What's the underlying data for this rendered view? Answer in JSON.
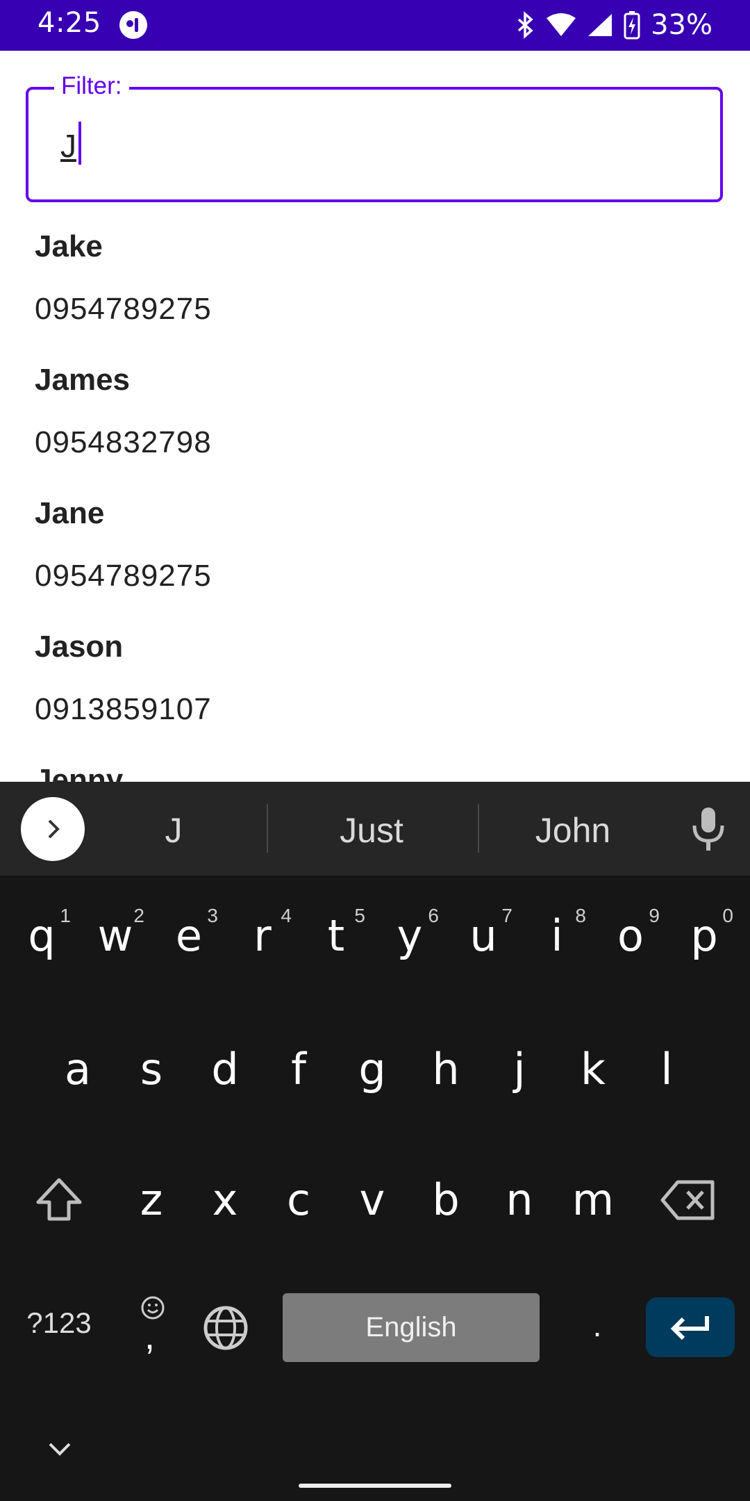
{
  "status": {
    "time": "4:25",
    "battery": "33%",
    "icons": [
      "app-icon",
      "bluetooth-icon",
      "wifi-icon",
      "signal-icon",
      "battery-charging-icon"
    ]
  },
  "filter": {
    "label": "Filter:",
    "value": "J"
  },
  "contacts": [
    {
      "name": "Jake",
      "phone": "0954789275"
    },
    {
      "name": "James",
      "phone": "0954832798"
    },
    {
      "name": "Jane",
      "phone": "0954789275"
    },
    {
      "name": "Jason",
      "phone": "0913859107"
    },
    {
      "name": "Jenny",
      "phone": ""
    }
  ],
  "keyboard": {
    "suggestions": [
      "J",
      "Just",
      "John"
    ],
    "row1": [
      "q",
      "w",
      "e",
      "r",
      "t",
      "y",
      "u",
      "i",
      "o",
      "p"
    ],
    "row1_hints": [
      "1",
      "2",
      "3",
      "4",
      "5",
      "6",
      "7",
      "8",
      "9",
      "0"
    ],
    "row2": [
      "a",
      "s",
      "d",
      "f",
      "g",
      "h",
      "j",
      "k",
      "l"
    ],
    "row3": [
      "z",
      "x",
      "c",
      "v",
      "b",
      "n",
      "m"
    ],
    "symbols_key": "?123",
    "comma": ",",
    "period": ".",
    "space_label": "English"
  },
  "colors": {
    "status_bar": "#3700b3",
    "accent": "#6200ee",
    "keyboard_bg": "#161616",
    "enter_key": "#003a5c"
  }
}
